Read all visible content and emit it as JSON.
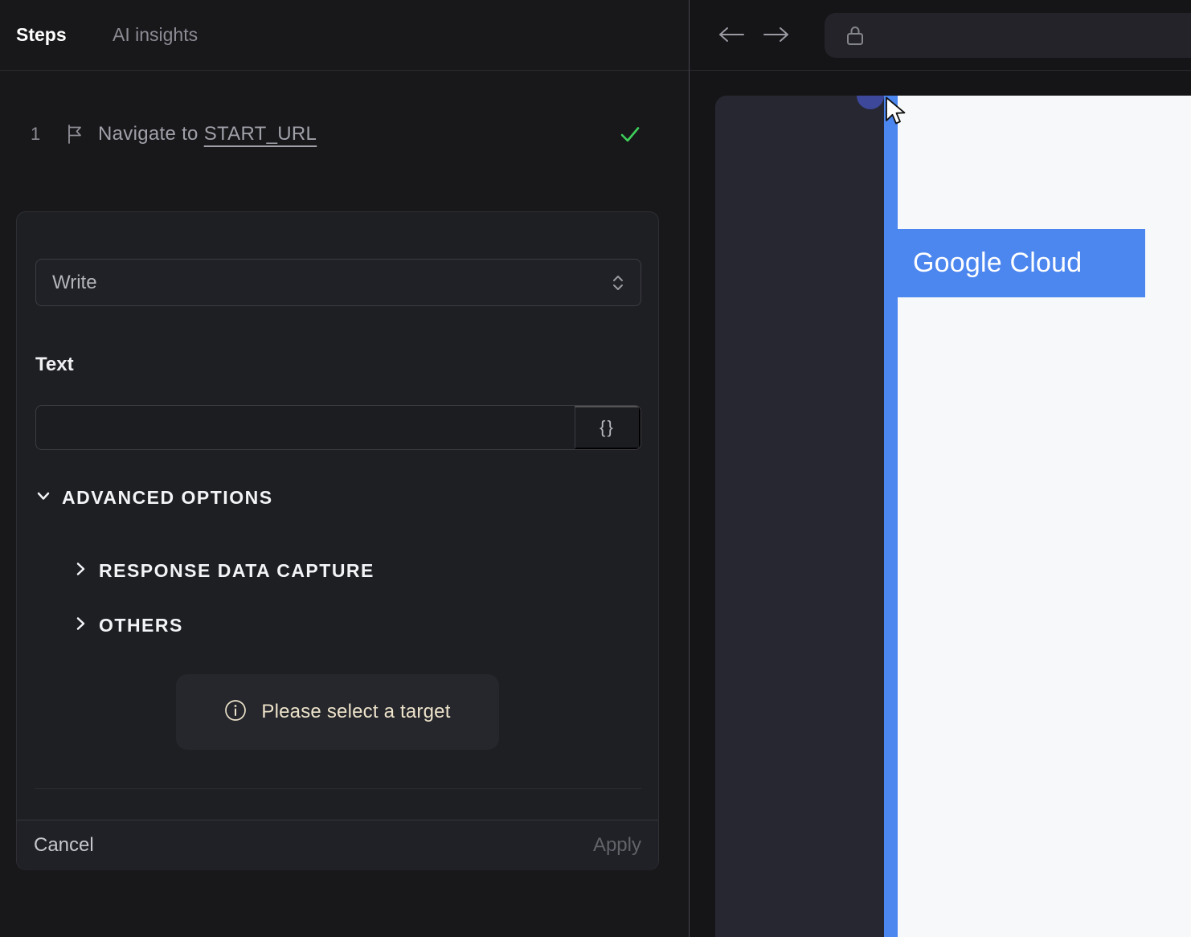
{
  "app": {
    "tabs": [
      {
        "label": "Steps",
        "active": true
      },
      {
        "label": "AI insights",
        "active": false
      }
    ]
  },
  "step": {
    "index": "1",
    "action": "Navigate to ",
    "target": "START_URL",
    "status": "success"
  },
  "editor": {
    "action_select": {
      "value": "Write"
    },
    "text_field": {
      "label": "Text",
      "value": "",
      "insert_variable_glyph": "{}"
    },
    "advanced": {
      "toggle_label": "ADVANCED OPTIONS",
      "expanded": true,
      "sections": [
        {
          "label": "RESPONSE DATA CAPTURE",
          "expanded": false
        },
        {
          "label": "OTHERS",
          "expanded": false
        }
      ]
    },
    "notice": {
      "message": "Please select a target"
    },
    "footer": {
      "cancel_label": "Cancel",
      "apply_label": "Apply",
      "apply_enabled": false
    }
  },
  "browser": {
    "address": ""
  },
  "preview": {
    "highlight_label": "Google Cloud"
  },
  "colors": {
    "accent_blue": "#4c86ef",
    "success_green": "#3ecf5a",
    "notice_cream": "#ede3cb",
    "badge_indigo": "#3d489a"
  }
}
